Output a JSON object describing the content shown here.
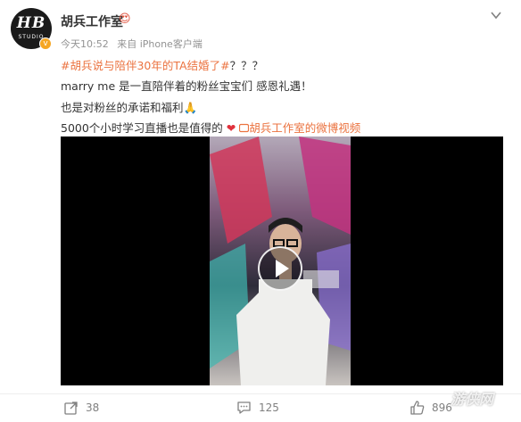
{
  "post": {
    "username": "胡兵工作室",
    "avatar_text": "HB",
    "avatar_subtext": "STUDIO",
    "time": "今天10:52",
    "source": "来自 iPhone客户端",
    "hashtag": "#胡兵说与陪伴30年的TA结婚了#",
    "hashtag_suffix": "？？？",
    "line2": "marry me 是一直陪伴着的粉丝宝宝们 感恩礼遇！",
    "line3": "也是对粉丝的承诺和福利🙏",
    "line4_text": "5000个小时学习直播也是值得的",
    "heart": "❤",
    "video_link": "胡兵工作室的微博视频"
  },
  "actions": {
    "share_count": "38",
    "comment_count": "125",
    "like_count": "896"
  },
  "watermark": "游侠网",
  "colors": {
    "link": "#eb7340",
    "heart": "#e0313c",
    "verified": "#f5a623"
  }
}
